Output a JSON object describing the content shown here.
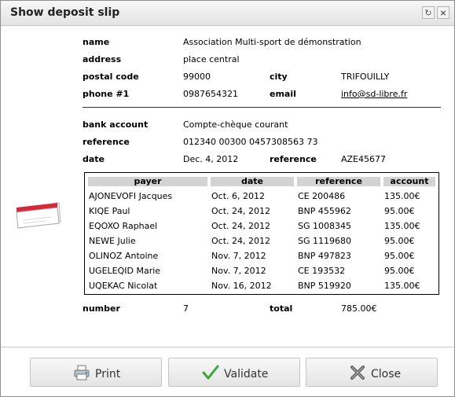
{
  "window": {
    "title": "Show deposit slip"
  },
  "labels": {
    "name": "name",
    "address": "address",
    "postal_code": "postal code",
    "city": "city",
    "phone": "phone #1",
    "email": "email",
    "bank_account": "bank account",
    "reference": "reference",
    "date": "date",
    "reference2": "reference",
    "number": "number",
    "total": "total"
  },
  "info": {
    "name": "Association Multi-sport de démonstration",
    "address": "place central",
    "postal_code": "99000",
    "city": "TRIFOUILLY",
    "phone": "0987654321",
    "email": "info@sd-libre.fr",
    "bank_account": "Compte-chèque courant",
    "reference": "012340 00300 0457308563 73",
    "date": "Dec. 4, 2012",
    "reference2": "AZE45677",
    "number": "7",
    "total": "785.00€"
  },
  "table": {
    "headers": [
      "payer",
      "date",
      "reference",
      "account"
    ],
    "rows": [
      [
        "AJONEVOFI Jacques",
        "Oct. 6, 2012",
        "CE 200486",
        "135.00€"
      ],
      [
        "KIQE Paul",
        "Oct. 24, 2012",
        "BNP 455962",
        "95.00€"
      ],
      [
        "EQOXO Raphael",
        "Oct. 24, 2012",
        "SG 1008345",
        "135.00€"
      ],
      [
        "NEWE Julie",
        "Oct. 24, 2012",
        "SG 1119680",
        "95.00€"
      ],
      [
        "OLINOZ Antoine",
        "Nov. 7, 2012",
        "BNP 497823",
        "95.00€"
      ],
      [
        "UGELEQID Marie",
        "Nov. 7, 2012",
        "CE 193532",
        "95.00€"
      ],
      [
        "UQEKAC Nicolat",
        "Nov. 16, 2012",
        "BNP 519920",
        "135.00€"
      ]
    ]
  },
  "buttons": {
    "print": "Print",
    "validate": "Validate",
    "close": "Close"
  },
  "colors": {
    "validate_check": "#3aa63a",
    "slip_stripe": "#d6283a"
  }
}
